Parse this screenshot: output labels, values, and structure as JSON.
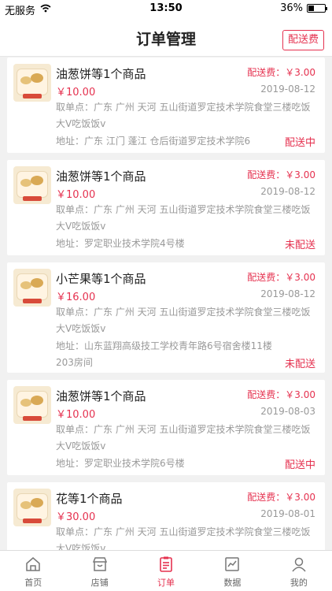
{
  "status_bar": {
    "carrier": "无服务",
    "time": "13:50",
    "battery": "36%",
    "battery_level": 0.36
  },
  "header": {
    "title": "订单管理",
    "action_label": "配送费"
  },
  "orders": [
    {
      "title": "油葱饼等1个商品",
      "price": "￥10.00",
      "fee": "配送费：￥3.00",
      "date": "2019-08-12",
      "pickup": "取单点：广东 广州 天河 五山街道罗定技术学院食堂三楼吃饭大V吃饭饭v",
      "address": "地址：广东 江门 蓬江 仓后街道罗定技术学院6",
      "status": "配送中"
    },
    {
      "title": "油葱饼等1个商品",
      "price": "￥10.00",
      "fee": "配送费：￥3.00",
      "date": "2019-08-12",
      "pickup": "取单点：广东 广州 天河 五山街道罗定技术学院食堂三楼吃饭大V吃饭饭v",
      "address": "地址：罗定职业技术学院4号楼",
      "status": "未配送"
    },
    {
      "title": "小芒果等1个商品",
      "price": "￥16.00",
      "fee": "配送费：￥3.00",
      "date": "2019-08-12",
      "pickup": "取单点：广东 广州 天河 五山街道罗定技术学院食堂三楼吃饭大V吃饭饭v",
      "address": "地址：山东蓝翔高级技工学校青年路6号宿舍楼11楼203房间",
      "status": "未配送"
    },
    {
      "title": "油葱饼等1个商品",
      "price": "￥10.00",
      "fee": "配送费：￥3.00",
      "date": "2019-08-03",
      "pickup": "取单点：广东 广州 天河 五山街道罗定技术学院食堂三楼吃饭大V吃饭饭v",
      "address": "地址：罗定职业技术学院6号楼",
      "status": "配送中"
    },
    {
      "title": "花等1个商品",
      "price": "￥30.00",
      "fee": "配送费：￥3.00",
      "date": "2019-08-01",
      "pickup": "取单点：广东 广州 天河 五山街道罗定技术学院食堂三楼吃饭大V吃饭饭v",
      "address": "",
      "status": ""
    }
  ],
  "tabs": [
    {
      "label": "首页",
      "icon": "home-icon"
    },
    {
      "label": "店铺",
      "icon": "store-icon"
    },
    {
      "label": "订单",
      "icon": "order-icon"
    },
    {
      "label": "数据",
      "icon": "chart-icon"
    },
    {
      "label": "我的",
      "icon": "user-icon"
    }
  ],
  "colors": {
    "accent": "#e5314f",
    "muted": "#999999",
    "background": "#f1f1f1"
  }
}
